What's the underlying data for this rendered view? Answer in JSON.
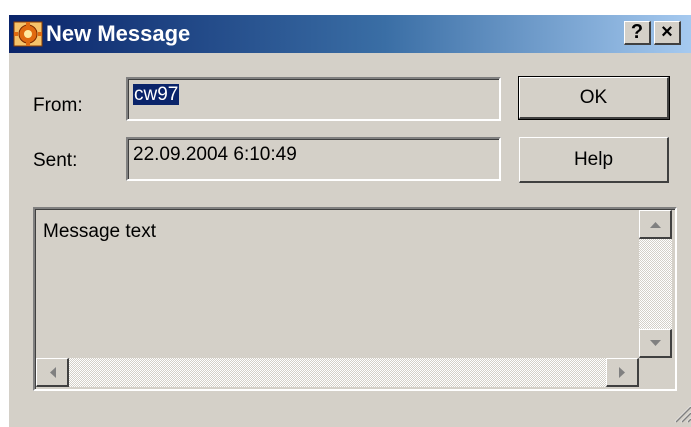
{
  "window": {
    "title": "New Message",
    "help_caption": "?",
    "close_caption": "×",
    "title_gradient_start": "#0a246a",
    "title_gradient_end": "#a6caf0",
    "face_color": "#d4d0c8",
    "selection_color": "#0a246a"
  },
  "form": {
    "from_label": "From:",
    "from_value": "cw97",
    "sent_label": "Sent:",
    "sent_value": "22.09.2004 6:10:49"
  },
  "buttons": {
    "ok_label": "OK",
    "help_label": "Help"
  },
  "message": {
    "text": "Message text"
  },
  "icons": {
    "app": "envelope-gear-icon",
    "scroll_up": "arrow-up-icon",
    "scroll_down": "arrow-down-icon",
    "scroll_left": "arrow-left-icon",
    "scroll_right": "arrow-right-icon",
    "resize": "resize-grip-icon"
  }
}
